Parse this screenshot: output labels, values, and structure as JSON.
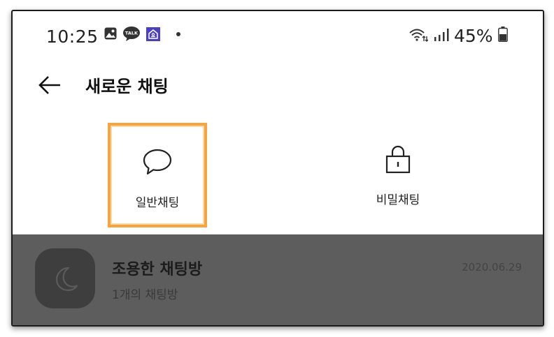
{
  "status_bar": {
    "time": "10:25",
    "talk_badge": "TALK",
    "battery_text": "45%",
    "icons": [
      "gallery-icon",
      "kakaotalk-icon",
      "home-app-icon",
      "wifi-icon",
      "signal-icon",
      "battery-icon"
    ]
  },
  "header": {
    "title": "새로운 채팅"
  },
  "options": [
    {
      "label": "일반채팅",
      "icon": "chat-bubble-icon",
      "selected": true
    },
    {
      "label": "비밀채팅",
      "icon": "lock-icon",
      "selected": false
    }
  ],
  "room": {
    "name": "조용한 채팅방",
    "subtitle": "1개의 채팅방",
    "date": "2020.06.29",
    "icon": "moon-icon"
  },
  "colors": {
    "highlight": "#f6a43d",
    "overlay": "#5d5d5d",
    "avatar": "#3e3e3e",
    "home_icon_bg": "#4b3fc4"
  }
}
